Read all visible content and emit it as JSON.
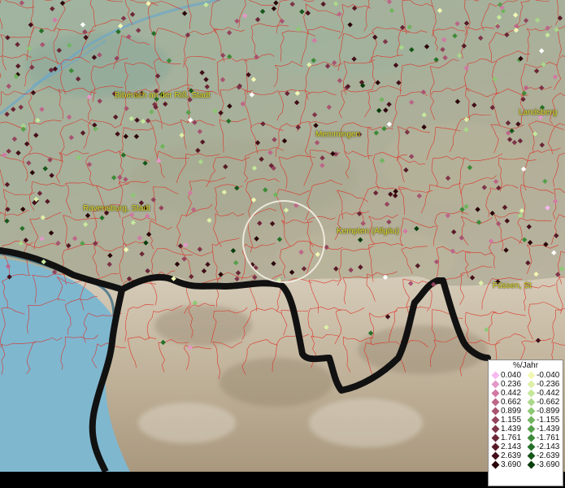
{
  "cities": [
    {
      "id": "biberach",
      "label": "Biberach an der Riß, Stadt"
    },
    {
      "id": "memmingen",
      "label": "Memmingen"
    },
    {
      "id": "landsberg",
      "label": "Landsberg"
    },
    {
      "id": "ravensburg",
      "label": "Ravensburg, Stadt"
    },
    {
      "id": "kempten",
      "label": "Kempten (Allgäu)"
    },
    {
      "id": "fuessen",
      "label": "Füssen, St"
    }
  ],
  "legend": {
    "title": "%/Jahr",
    "rows": [
      {
        "pos": "0.040",
        "neg": "-0.040",
        "pos_color": "#f6b8ee",
        "neg_color": "#f2f7b4"
      },
      {
        "pos": "0.236",
        "neg": "-0.236",
        "pos_color": "#e398c8",
        "neg_color": "#ddf0a8"
      },
      {
        "pos": "0.442",
        "neg": "-0.442",
        "pos_color": "#d07aa4",
        "neg_color": "#c5e89c"
      },
      {
        "pos": "0.662",
        "neg": "-0.662",
        "pos_color": "#bd6688",
        "neg_color": "#aad88a"
      },
      {
        "pos": "0.899",
        "neg": "-0.899",
        "pos_color": "#a85470",
        "neg_color": "#8dc874"
      },
      {
        "pos": "1.155",
        "neg": "-1.155",
        "pos_color": "#93445c",
        "neg_color": "#70b45e"
      },
      {
        "pos": "1.439",
        "neg": "-1.439",
        "pos_color": "#7e3448",
        "neg_color": "#55a04a"
      },
      {
        "pos": "1.761",
        "neg": "-1.761",
        "pos_color": "#6a2636",
        "neg_color": "#3d8a38"
      },
      {
        "pos": "2.143",
        "neg": "-2.143",
        "pos_color": "#561a26",
        "neg_color": "#267028"
      },
      {
        "pos": "2.639",
        "neg": "-2.639",
        "pos_color": "#420e18",
        "neg_color": "#16561a"
      },
      {
        "pos": "3.690",
        "neg": "-3.690",
        "pos_color": "#2a0408",
        "neg_color": "#083c0c"
      }
    ]
  },
  "colors": {
    "boundary": "#e0281e",
    "lake": "#7fb7cf",
    "label": "#e6e02a",
    "border": "#111111"
  }
}
